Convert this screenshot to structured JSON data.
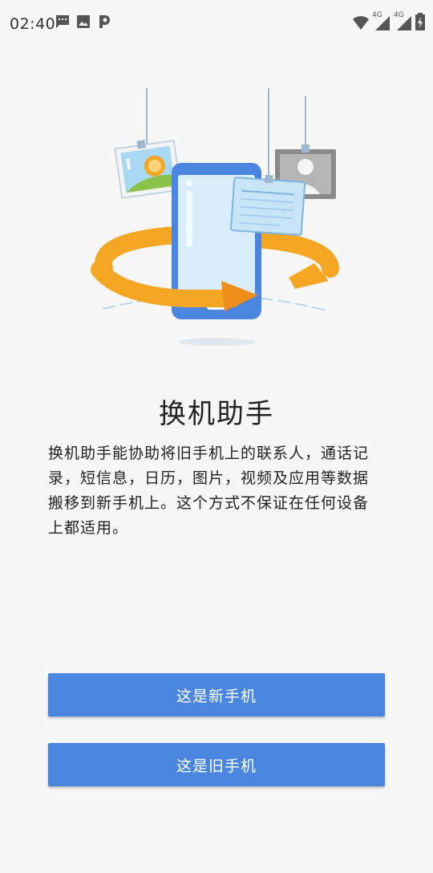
{
  "status_bar": {
    "time": "02:40",
    "left_icons": [
      "message-icon",
      "image-icon",
      "p-app-icon"
    ],
    "right_icons": [
      "wifi-icon",
      "signal-4g-icon",
      "signal-4g-icon",
      "battery-charging-icon"
    ],
    "network_label_1": "4G",
    "network_label_2": "4G"
  },
  "main": {
    "title": "换机助手",
    "description": "换机助手能协助将旧手机上的联系人，通话记录，短信息，日历，图片，视频及应用等数据搬移到新手机上。这个方式不保证在任何设备上都适用。"
  },
  "buttons": {
    "new_phone_label": "这是新手机",
    "old_phone_label": "这是旧手机"
  },
  "colors": {
    "accent": "#4a86e0",
    "phone_body": "#4a86e0",
    "arrow_orange": "#f5a623",
    "background": "#f7f7f7"
  }
}
